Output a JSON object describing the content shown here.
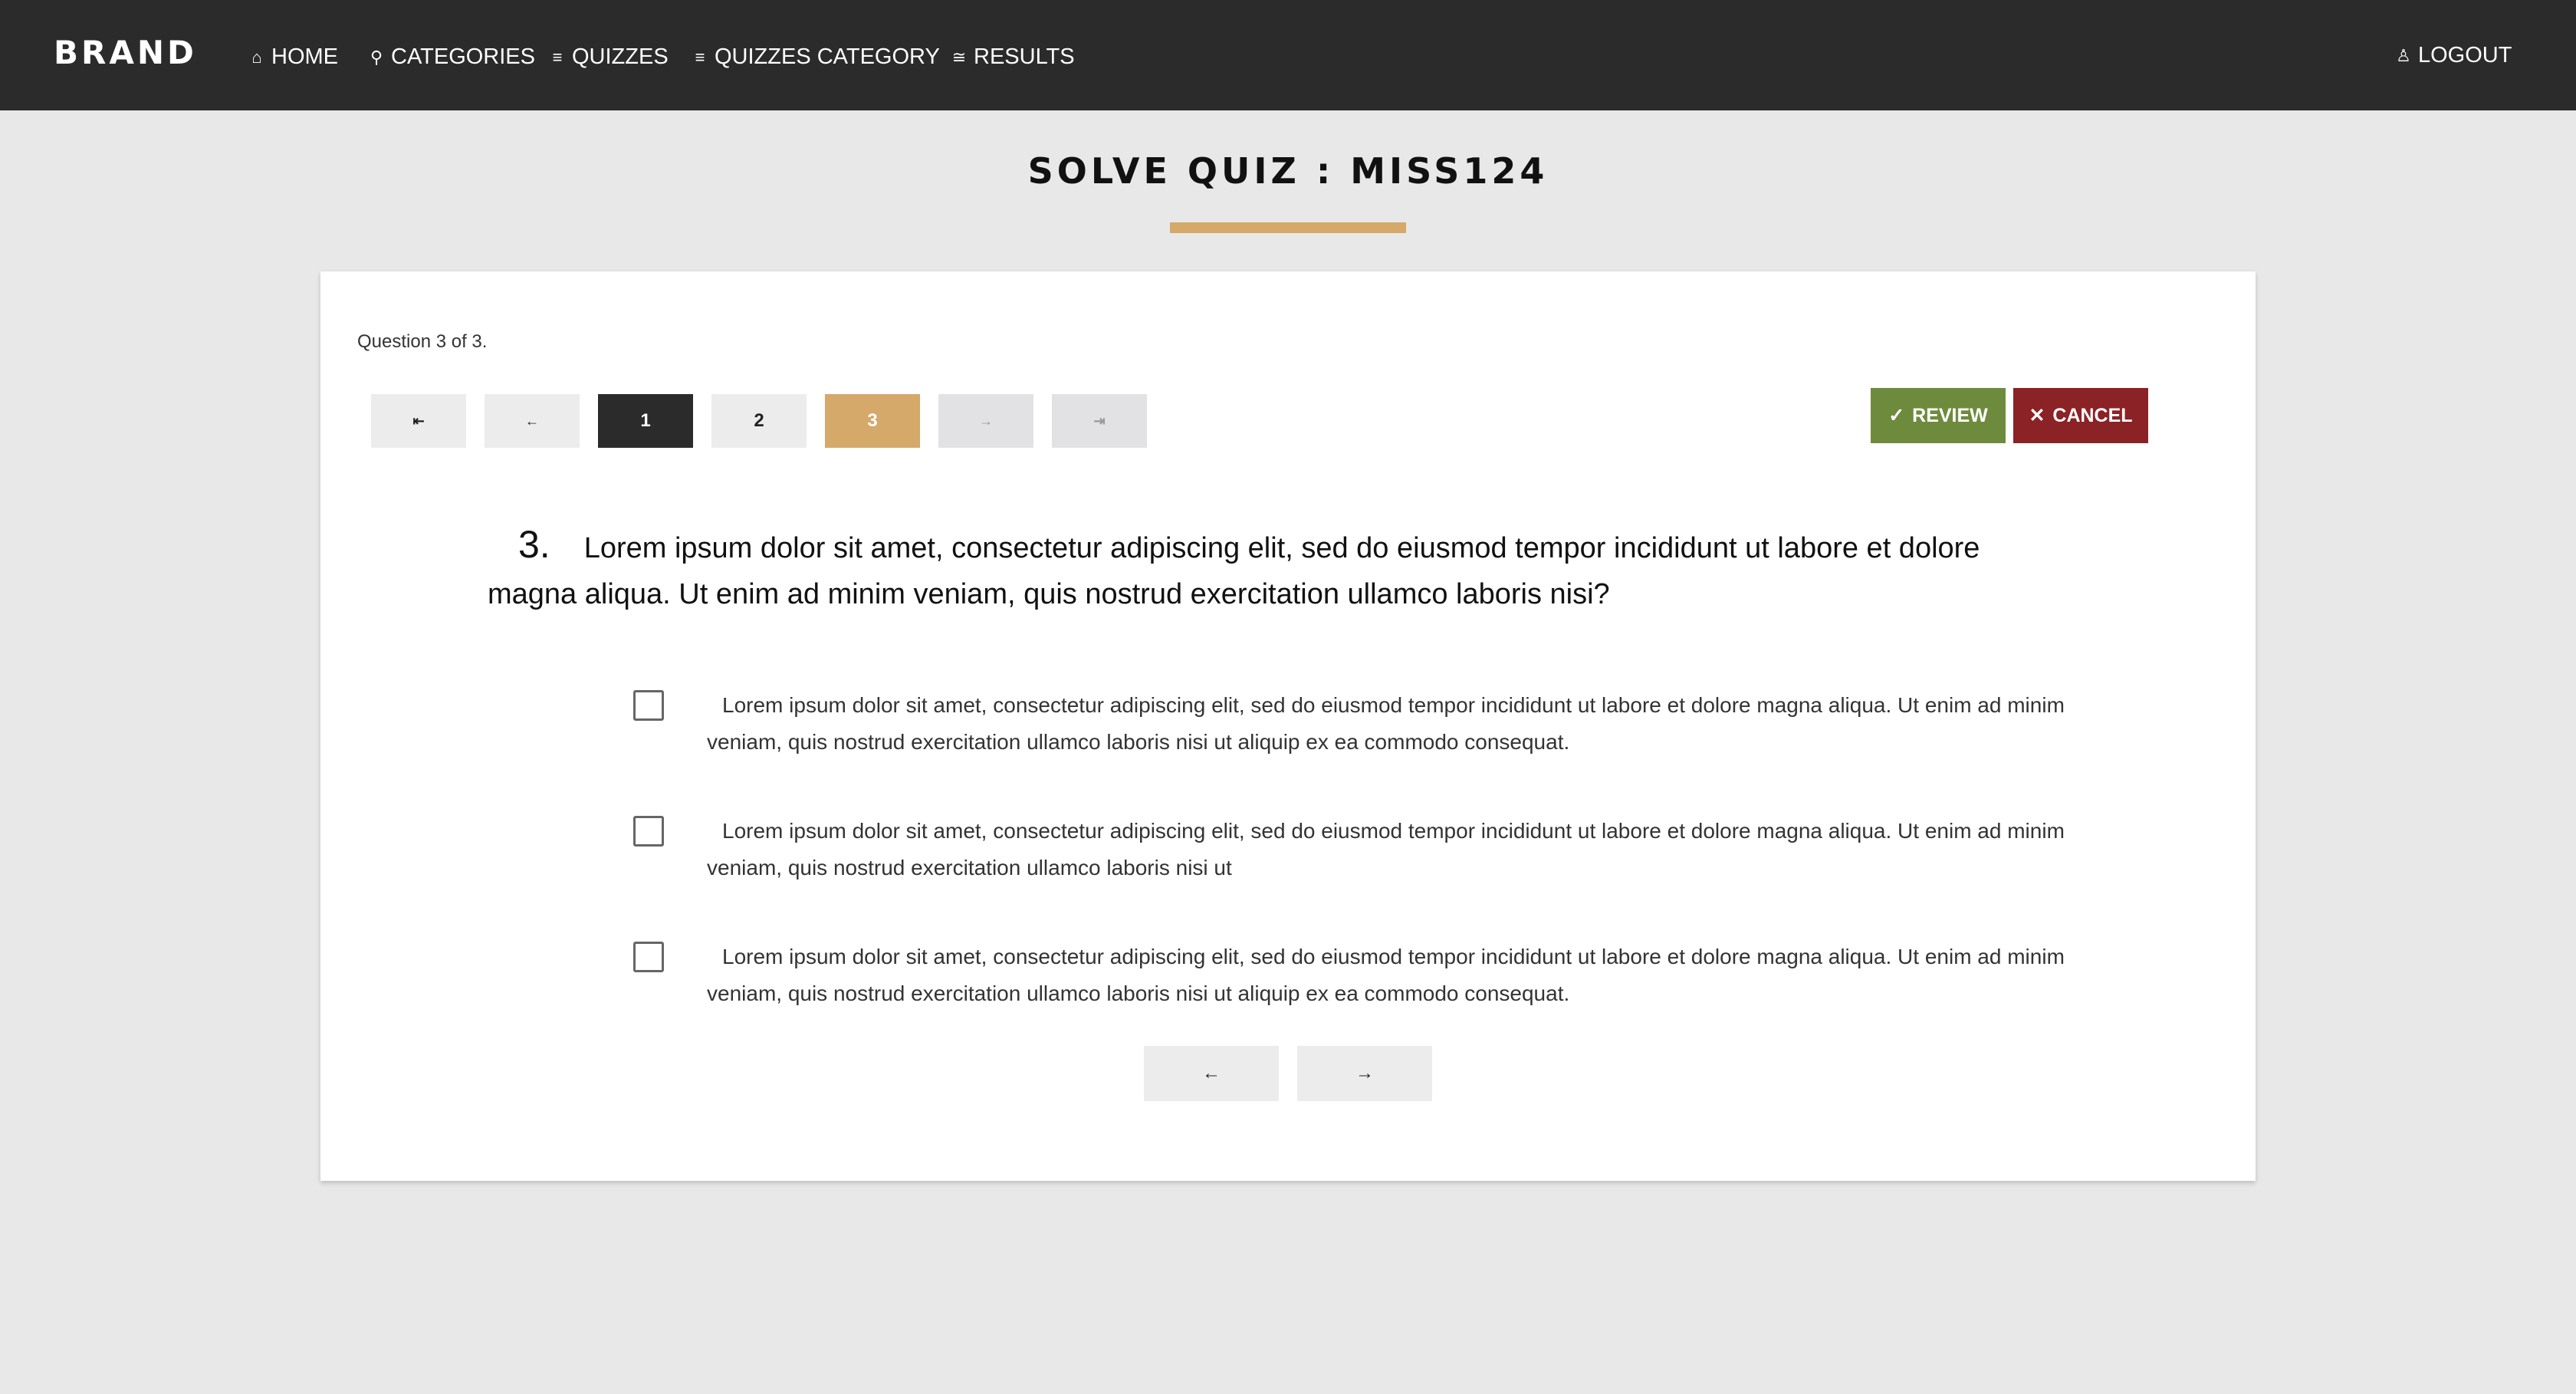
{
  "navbar": {
    "brand": "BRAND",
    "items": [
      {
        "icon": "home-icon",
        "glyph": "⌂",
        "label": "HOME"
      },
      {
        "icon": "pin-icon",
        "glyph": "⚲",
        "label": "CATEGORIES"
      },
      {
        "icon": "list-icon",
        "glyph": "≡",
        "label": "QUIZZES"
      },
      {
        "icon": "list-icon",
        "glyph": "≡",
        "label": "QUIZZES CATEGORY"
      },
      {
        "icon": "results-icon",
        "glyph": "≅",
        "label": "RESULTS"
      }
    ],
    "logout": {
      "icon": "user-icon",
      "glyph": "♙",
      "label": "LOGOUT"
    }
  },
  "page": {
    "title": "SOLVE QUIZ : MISS124"
  },
  "quiz": {
    "progress": "Question 3 of 3.",
    "pager": {
      "first": "⇤",
      "prev": "←",
      "pages": [
        "1",
        "2",
        "3"
      ],
      "next": "→",
      "last": "⇥"
    },
    "review_label": "REVIEW",
    "review_glyph": "✓",
    "cancel_label": "CANCEL",
    "cancel_glyph": "✕",
    "question_number": "3.",
    "question_text": "Lorem ipsum dolor sit amet, consectetur adipiscing elit, sed do eiusmod tempor incididunt ut labore et dolore magna aliqua. Ut enim ad minim veniam, quis nostrud exercitation ullamco laboris nisi?",
    "options": [
      {
        "text": "Lorem ipsum dolor sit amet, consectetur adipiscing elit, sed do eiusmod tempor incididunt ut labore et dolore magna aliqua. Ut enim ad minim veniam, quis nostrud exercitation ullamco laboris nisi ut aliquip ex ea commodo consequat.",
        "checked": false
      },
      {
        "text": "Lorem ipsum dolor sit amet, consectetur adipiscing elit, sed do eiusmod tempor incididunt ut labore et dolore magna aliqua. Ut enim ad minim veniam, quis nostrud exercitation ullamco laboris nisi ut",
        "checked": false
      },
      {
        "text": "Lorem ipsum dolor sit amet, consectetur adipiscing elit, sed do eiusmod tempor incididunt ut labore et dolore magna aliqua. Ut enim ad minim veniam, quis nostrud exercitation ullamco laboris nisi ut aliquip ex ea commodo consequat.",
        "checked": false
      }
    ],
    "bottom_prev": "←",
    "bottom_next": "→"
  },
  "colors": {
    "navbar_bg": "#2b2b2b",
    "accent_gold": "#d4a96a",
    "review_green": "#6e8b3d",
    "cancel_red": "#8b2226",
    "page_bg": "#e8e8e8"
  }
}
